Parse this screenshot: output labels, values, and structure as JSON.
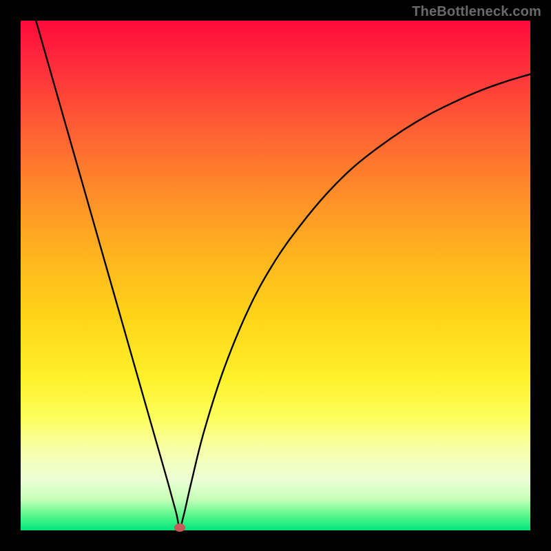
{
  "watermark": "TheBottleneck.com",
  "marker": {
    "x_frac": 0.312,
    "y_frac": 0.994
  },
  "chart_data": {
    "type": "line",
    "title": "",
    "xlabel": "",
    "ylabel": "",
    "xlim": [
      0,
      1
    ],
    "ylim": [
      0,
      1
    ],
    "series": [
      {
        "name": "curve",
        "x": [
          0.03,
          0.06,
          0.09,
          0.12,
          0.15,
          0.18,
          0.21,
          0.24,
          0.27,
          0.29,
          0.305,
          0.312,
          0.32,
          0.335,
          0.36,
          0.4,
          0.45,
          0.5,
          0.55,
          0.6,
          0.65,
          0.7,
          0.75,
          0.8,
          0.85,
          0.9,
          0.95,
          1.0
        ],
        "y": [
          1.0,
          0.895,
          0.79,
          0.685,
          0.58,
          0.475,
          0.37,
          0.265,
          0.16,
          0.09,
          0.035,
          0.006,
          0.03,
          0.095,
          0.195,
          0.32,
          0.44,
          0.53,
          0.6,
          0.66,
          0.71,
          0.75,
          0.785,
          0.815,
          0.84,
          0.862,
          0.88,
          0.895
        ]
      }
    ],
    "annotations": []
  }
}
